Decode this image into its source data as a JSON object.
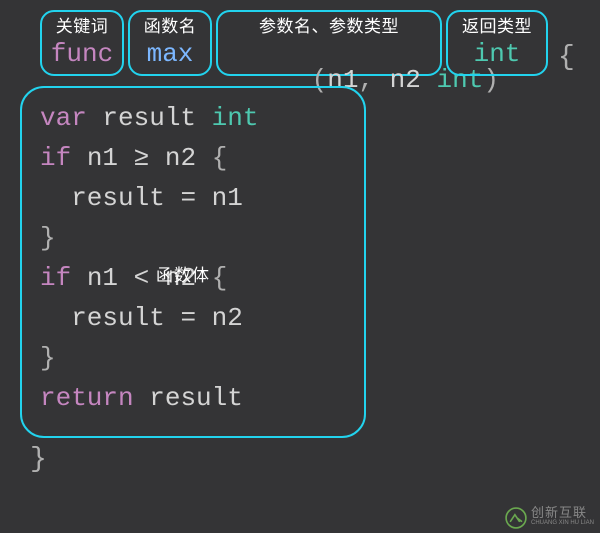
{
  "header": {
    "keyword": {
      "label": "关键词",
      "value": "func"
    },
    "funcname": {
      "label": "函数名",
      "value": "max"
    },
    "params": {
      "label": "参数名、参数类型",
      "open": "(",
      "p1": "n1",
      "comma": ",",
      "p2": "n2",
      "type": "int",
      "close": ")"
    },
    "rettype": {
      "label": "返回类型",
      "value": "int"
    },
    "open_brace": "{"
  },
  "body": {
    "label": "函数体",
    "lines": [
      {
        "segments": [
          {
            "t": "var",
            "c": "c-keyword"
          },
          {
            "t": " ",
            "c": ""
          },
          {
            "t": "result",
            "c": "c-ident"
          },
          {
            "t": " ",
            "c": ""
          },
          {
            "t": "int",
            "c": "c-type"
          }
        ]
      },
      {
        "segments": [
          {
            "t": "if",
            "c": "c-keyword"
          },
          {
            "t": " ",
            "c": ""
          },
          {
            "t": "n1",
            "c": "c-ident"
          },
          {
            "t": " ",
            "c": ""
          },
          {
            "t": "≥",
            "c": "c-ident"
          },
          {
            "t": " ",
            "c": ""
          },
          {
            "t": "n2",
            "c": "c-ident"
          },
          {
            "t": " ",
            "c": ""
          },
          {
            "t": "{",
            "c": "c-paren"
          }
        ]
      },
      {
        "segments": [
          {
            "t": "  result",
            "c": "c-ident"
          },
          {
            "t": " ",
            "c": ""
          },
          {
            "t": "=",
            "c": "c-ident"
          },
          {
            "t": " ",
            "c": ""
          },
          {
            "t": "n1",
            "c": "c-ident"
          }
        ]
      },
      {
        "segments": [
          {
            "t": "}",
            "c": "c-paren"
          }
        ]
      },
      {
        "segments": [
          {
            "t": "if",
            "c": "c-keyword"
          },
          {
            "t": " ",
            "c": ""
          },
          {
            "t": "n1",
            "c": "c-ident"
          },
          {
            "t": " ",
            "c": ""
          },
          {
            "t": "<",
            "c": "c-ident"
          },
          {
            "t": " ",
            "c": ""
          },
          {
            "t": "n2",
            "c": "c-ident"
          },
          {
            "t": " ",
            "c": ""
          },
          {
            "t": "{",
            "c": "c-paren"
          }
        ]
      },
      {
        "segments": [
          {
            "t": "  result",
            "c": "c-ident"
          },
          {
            "t": " ",
            "c": ""
          },
          {
            "t": "=",
            "c": "c-ident"
          },
          {
            "t": " ",
            "c": ""
          },
          {
            "t": "n2",
            "c": "c-ident"
          }
        ]
      },
      {
        "segments": [
          {
            "t": "}",
            "c": "c-paren"
          }
        ]
      },
      {
        "segments": [
          {
            "t": "return",
            "c": "c-keyword"
          },
          {
            "t": " ",
            "c": ""
          },
          {
            "t": "result",
            "c": "c-ident"
          }
        ]
      }
    ]
  },
  "close_brace": "}",
  "watermark": {
    "line1": "创新互联",
    "line2": "CHUANG XIN HU LIAN"
  }
}
